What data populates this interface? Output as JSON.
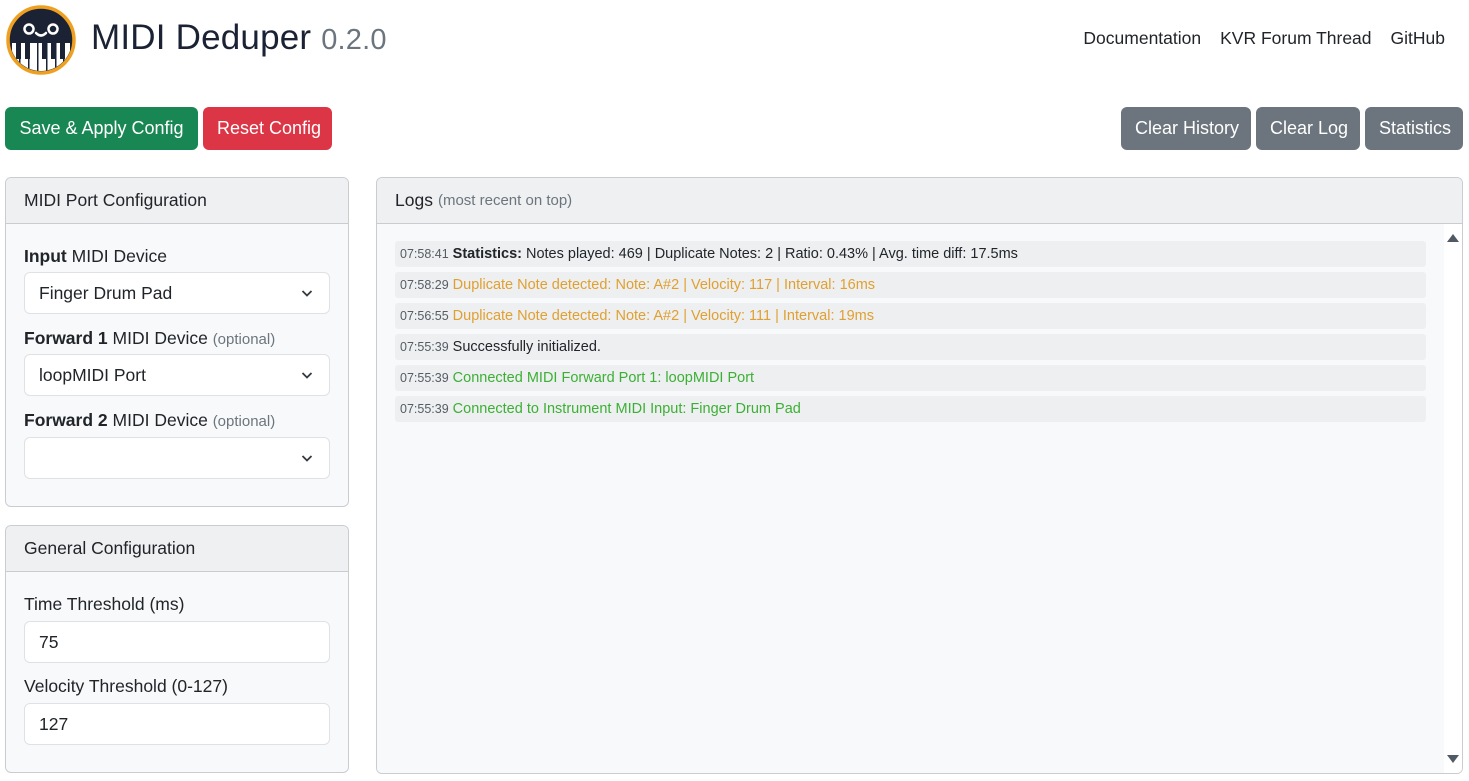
{
  "header": {
    "app_name": "MIDI Deduper",
    "version": "0.2.0",
    "nav": [
      {
        "label": "Documentation"
      },
      {
        "label": "KVR Forum Thread"
      },
      {
        "label": "GitHub"
      }
    ]
  },
  "toolbar": {
    "save_label": "Save & Apply Config",
    "reset_label": "Reset Config",
    "clear_history_label": "Clear History",
    "clear_log_label": "Clear Log",
    "statistics_label": "Statistics"
  },
  "colors": {
    "success": "#198754",
    "danger": "#dc3545",
    "secondary": "#6c757d",
    "log_warning": "#e0a030",
    "log_success": "#3cb034",
    "logo_ring": "#f0a020",
    "logo_face": "#1a2233"
  },
  "port_config": {
    "title": "MIDI Port Configuration",
    "input": {
      "label_bold": "Input",
      "label_rest": "MIDI Device",
      "value": "Finger Drum Pad"
    },
    "forward1": {
      "label_bold": "Forward 1",
      "label_rest": "MIDI Device",
      "optional": "(optional)",
      "value": "loopMIDI Port"
    },
    "forward2": {
      "label_bold": "Forward 2",
      "label_rest": "MIDI Device",
      "optional": "(optional)",
      "value": ""
    }
  },
  "general_config": {
    "title": "General Configuration",
    "time_threshold": {
      "label": "Time Threshold (ms)",
      "value": "75"
    },
    "velocity_threshold": {
      "label": "Velocity Threshold (0-127)",
      "value": "127"
    }
  },
  "logs": {
    "title": "Logs",
    "subtitle": "(most recent on top)",
    "entries": [
      {
        "time": "07:58:41",
        "prefix": "Statistics:",
        "text": "Notes played: 469 | Duplicate Notes: 2 | Ratio: 0.43% | Avg. time diff: 17.5ms",
        "level": "default"
      },
      {
        "time": "07:58:29",
        "prefix": "",
        "text": "Duplicate Note detected: Note: A#2 | Velocity: 117 | Interval: 16ms",
        "level": "warning"
      },
      {
        "time": "07:56:55",
        "prefix": "",
        "text": "Duplicate Note detected: Note: A#2 | Velocity: 111 | Interval: 19ms",
        "level": "warning"
      },
      {
        "time": "07:55:39",
        "prefix": "",
        "text": "Successfully initialized.",
        "level": "default"
      },
      {
        "time": "07:55:39",
        "prefix": "",
        "text": "Connected MIDI Forward Port 1: loopMIDI Port",
        "level": "success"
      },
      {
        "time": "07:55:39",
        "prefix": "",
        "text": "Connected to Instrument MIDI Input: Finger Drum Pad",
        "level": "success"
      }
    ]
  }
}
